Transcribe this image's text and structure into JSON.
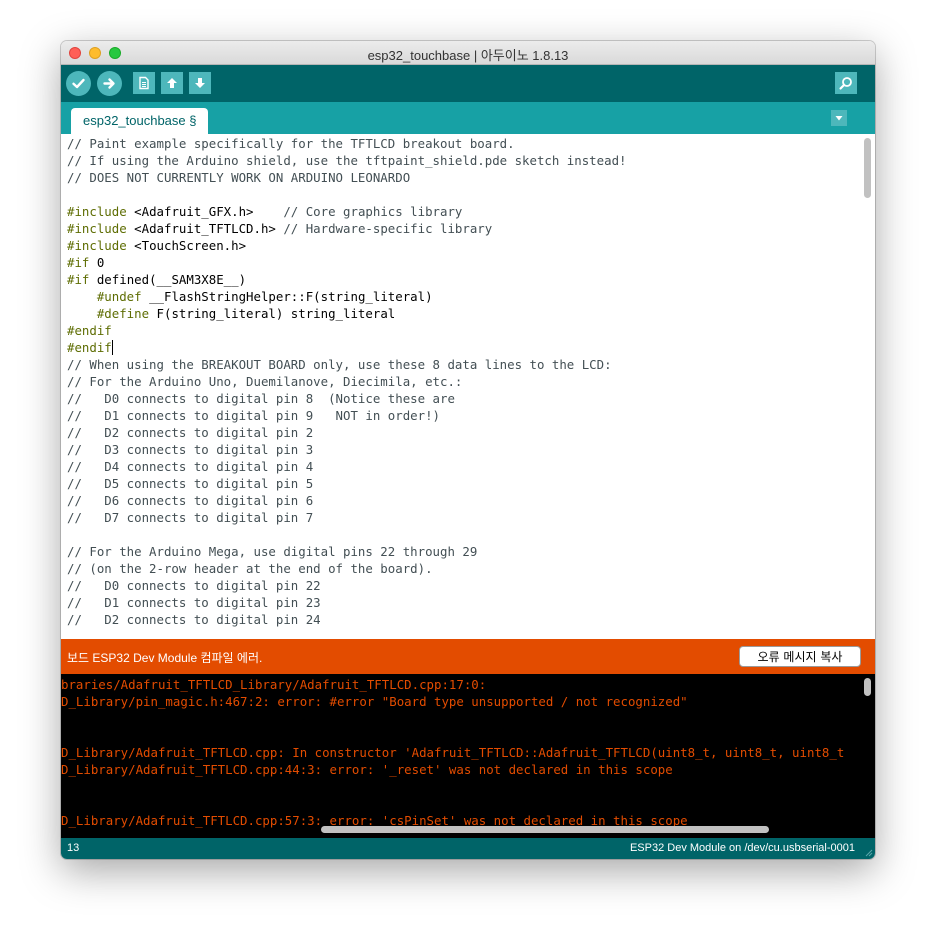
{
  "window": {
    "title": "esp32_touchbase | 아두이노 1.8.13"
  },
  "toolbar": {
    "buttons": [
      {
        "name": "verify",
        "icon": "check-icon"
      },
      {
        "name": "upload",
        "icon": "arrow-right-icon"
      },
      {
        "name": "new",
        "icon": "new-file-icon"
      },
      {
        "name": "open",
        "icon": "arrow-up-icon"
      },
      {
        "name": "save",
        "icon": "arrow-down-icon"
      },
      {
        "name": "serial-monitor",
        "icon": "magnifier-icon"
      }
    ]
  },
  "tabs": [
    {
      "label": "esp32_touchbase §",
      "active": true
    }
  ],
  "editor": {
    "lines": [
      [
        {
          "t": "// Paint example specifically for the TFTLCD breakout board.",
          "c": "comment"
        }
      ],
      [
        {
          "t": "// If using the Arduino shield, use the tftpaint_shield.pde sketch instead!",
          "c": "comment"
        }
      ],
      [
        {
          "t": "// DOES NOT CURRENTLY WORK ON ARDUINO LEONARDO",
          "c": "comment"
        }
      ],
      [],
      [
        {
          "t": "#include",
          "c": "pp"
        },
        {
          "t": " <Adafruit_GFX.h>    ",
          "c": "plain"
        },
        {
          "t": "// Core graphics library",
          "c": "comment"
        }
      ],
      [
        {
          "t": "#include",
          "c": "pp"
        },
        {
          "t": " <Adafruit_TFTLCD.h> ",
          "c": "plain"
        },
        {
          "t": "// Hardware-specific library",
          "c": "comment"
        }
      ],
      [
        {
          "t": "#include",
          "c": "pp"
        },
        {
          "t": " <TouchScreen.h>",
          "c": "plain"
        }
      ],
      [
        {
          "t": "#if",
          "c": "pp"
        },
        {
          "t": " 0",
          "c": "plain"
        }
      ],
      [
        {
          "t": "#if",
          "c": "pp"
        },
        {
          "t": " defined(__SAM3X8E__)",
          "c": "plain"
        }
      ],
      [
        {
          "t": "    #undef",
          "c": "pp"
        },
        {
          "t": " __FlashStringHelper::F(string_literal)",
          "c": "plain"
        }
      ],
      [
        {
          "t": "    #define",
          "c": "pp"
        },
        {
          "t": " F(string_literal) string_literal",
          "c": "plain"
        }
      ],
      [
        {
          "t": "#endif",
          "c": "pp"
        }
      ],
      [
        {
          "t": "#endif",
          "c": "pp"
        }
      ],
      [
        {
          "t": "// When using the BREAKOUT BOARD only, use these 8 data lines to the LCD:",
          "c": "comment"
        }
      ],
      [
        {
          "t": "// For the Arduino Uno, Duemilanove, Diecimila, etc.:",
          "c": "comment"
        }
      ],
      [
        {
          "t": "//   D0 connects to digital pin 8  (Notice these are",
          "c": "comment"
        }
      ],
      [
        {
          "t": "//   D1 connects to digital pin 9   NOT in order!)",
          "c": "comment"
        }
      ],
      [
        {
          "t": "//   D2 connects to digital pin 2",
          "c": "comment"
        }
      ],
      [
        {
          "t": "//   D3 connects to digital pin 3",
          "c": "comment"
        }
      ],
      [
        {
          "t": "//   D4 connects to digital pin 4",
          "c": "comment"
        }
      ],
      [
        {
          "t": "//   D5 connects to digital pin 5",
          "c": "comment"
        }
      ],
      [
        {
          "t": "//   D6 connects to digital pin 6",
          "c": "comment"
        }
      ],
      [
        {
          "t": "//   D7 connects to digital pin 7",
          "c": "comment"
        }
      ],
      [],
      [
        {
          "t": "// For the Arduino Mega, use digital pins 22 through 29",
          "c": "comment"
        }
      ],
      [
        {
          "t": "// (on the 2-row header at the end of the board).",
          "c": "comment"
        }
      ],
      [
        {
          "t": "//   D0 connects to digital pin 22",
          "c": "comment"
        }
      ],
      [
        {
          "t": "//   D1 connects to digital pin 23",
          "c": "comment"
        }
      ],
      [
        {
          "t": "//   D2 connects to digital pin 24",
          "c": "comment"
        }
      ]
    ]
  },
  "status": {
    "message": "보드 ESP32 Dev Module 컴파일 에러.",
    "copy_button": "오류 메시지 복사"
  },
  "console": {
    "lines": [
      "braries/Adafruit_TFTLCD_Library/Adafruit_TFTLCD.cpp:17:0:",
      "D_Library/pin_magic.h:467:2: error: #error \"Board type unsupported / not recognized\"",
      "",
      "",
      "D_Library/Adafruit_TFTLCD.cpp: In constructor 'Adafruit_TFTLCD::Adafruit_TFTLCD(uint8_t, uint8_t, uint8_t",
      "D_Library/Adafruit_TFTLCD.cpp:44:3: error: '_reset' was not declared in this scope",
      "",
      "",
      "D_Library/Adafruit_TFTLCD.cpp:57:3: error: 'csPinSet' was not declared in this scope"
    ]
  },
  "bottom_bar": {
    "line_number": "13",
    "board_info": "ESP32 Dev Module on /dev/cu.usbserial-0001"
  },
  "colors": {
    "toolbar": "#006468",
    "tabstrip": "#17a1a5",
    "button": "#4db7bb",
    "error": "#e34c00",
    "preprocessor": "#5e6d03",
    "comment": "#434f54"
  }
}
